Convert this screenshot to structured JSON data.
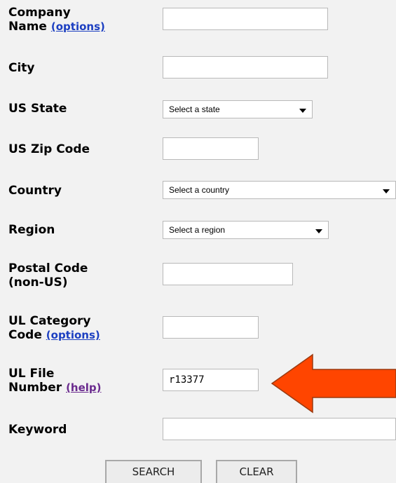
{
  "fields": {
    "company": {
      "label": "Company",
      "label2": "Name",
      "link": "(options)",
      "value": ""
    },
    "city": {
      "label": "City",
      "value": ""
    },
    "state": {
      "label": "US State",
      "selected": "Select a state"
    },
    "zip": {
      "label": "US Zip Code",
      "value": ""
    },
    "country": {
      "label": "Country",
      "selected": "Select a country"
    },
    "region": {
      "label": "Region",
      "selected": "Select a region"
    },
    "postal": {
      "label": "Postal Code",
      "label2": "(non-US)",
      "value": ""
    },
    "category": {
      "label": "UL Category",
      "label2": "Code",
      "link": "(options)",
      "value": ""
    },
    "file": {
      "label": "UL File",
      "label2": "Number",
      "link": "(help)",
      "value": "r13377"
    },
    "keyword": {
      "label": "Keyword",
      "value": ""
    }
  },
  "buttons": {
    "search": "SEARCH",
    "clear": "CLEAR"
  },
  "annotation": {
    "arrow_color": "#ff4500"
  }
}
